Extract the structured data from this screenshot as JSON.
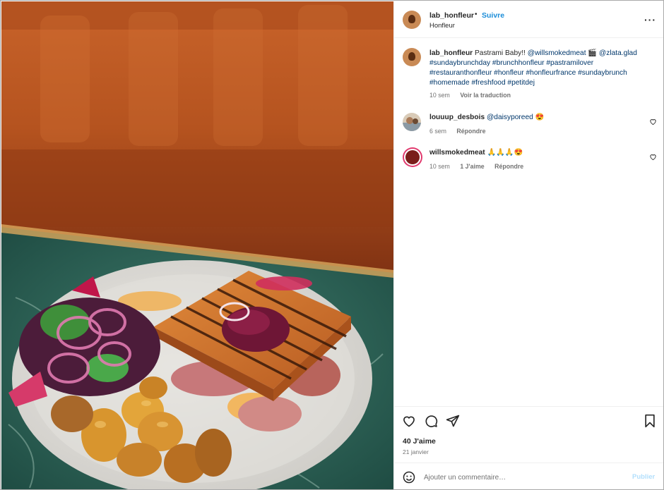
{
  "post": {
    "image_alt": "Pastrami sandwich plate",
    "username": "lab_honfleur",
    "dot": "•",
    "follow_label": "Suivre",
    "location": "Honfleur",
    "more_icon": "more-icon"
  },
  "caption": {
    "username": "lab_honfleur",
    "text": "Pastrami Baby!!",
    "mention1": "@willsmokedmeat",
    "emoji": "🎬",
    "mention2": "@zlata.glad",
    "hashtags": "#sundaybrunchday #brunchhonfleur #pastramilover #restauranthonfleur #honfleur #honfleurfrance #sundaybrunch #homemade #freshfood #petitdej",
    "time": "10 sem",
    "translate": "Voir la traduction"
  },
  "comments": [
    {
      "username": "louuup_desbois",
      "mention": "@daisyporeed",
      "emoji": "😍",
      "time": "6 sem",
      "reply": "Répondre"
    },
    {
      "username": "willsmokedmeat",
      "text": "🙏🙏🙏😍",
      "time": "10 sem",
      "likes": "1 J'aime",
      "reply": "Répondre"
    }
  ],
  "actions": {
    "likes": "40 J'aime",
    "date": "21 janvier"
  },
  "add_comment": {
    "placeholder": "Ajouter un commentaire…",
    "publish": "Publier"
  },
  "colors": {
    "link": "#00376b",
    "follow": "#1a8cd8",
    "publish_disabled": "#b2dffc"
  }
}
